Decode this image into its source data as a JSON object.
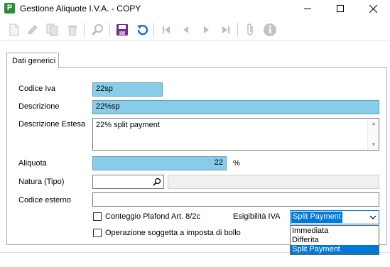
{
  "window": {
    "title": "Gestione Aliquote I.V.A. - COPY",
    "app_icon_letter": "P"
  },
  "toolbar": {
    "buttons": [
      {
        "name": "new",
        "icon": "new-document-icon"
      },
      {
        "name": "edit",
        "icon": "pencil-icon"
      },
      {
        "name": "copy",
        "icon": "copy-icon"
      },
      {
        "name": "delete",
        "icon": "trash-icon"
      },
      {
        "name": "search",
        "icon": "search-icon"
      },
      {
        "name": "save",
        "icon": "save-icon"
      },
      {
        "name": "undo",
        "icon": "undo-icon"
      },
      {
        "name": "first",
        "icon": "first-record-icon"
      },
      {
        "name": "previous",
        "icon": "previous-record-icon"
      },
      {
        "name": "next",
        "icon": "next-record-icon"
      },
      {
        "name": "last",
        "icon": "last-record-icon"
      },
      {
        "name": "attach",
        "icon": "paperclip-icon"
      },
      {
        "name": "info",
        "icon": "info-icon"
      }
    ]
  },
  "tab": {
    "label": "Dati generici"
  },
  "form": {
    "codice_iva": {
      "label": "Codice Iva",
      "value": "22sp"
    },
    "descrizione": {
      "label": "Descrizione",
      "value": "22%sp"
    },
    "descrizione_estesa": {
      "label": "Descrizione Estesa",
      "value": "22% split payment"
    },
    "aliquota": {
      "label": "Aliquota",
      "value": "22",
      "unit": "%"
    },
    "natura": {
      "label": "Natura (Tipo)",
      "value": "",
      "description": ""
    },
    "codice_esterno": {
      "label": "Codice esterno",
      "value": ""
    },
    "conteggio_plafond": {
      "label": "Conteggio Plafond Art. 8/2c",
      "checked": false
    },
    "operazione_bollo": {
      "label": "Operazione soggetta a imposta di bollo",
      "checked": false
    },
    "esigibilita": {
      "label": "Esigibilità IVA",
      "selected": "Split Payment",
      "options": [
        "Immediata",
        "Differita",
        "Split Payment"
      ]
    }
  },
  "colors": {
    "field_highlight": "#87cdea",
    "selection": "#0078d7",
    "save_icon": "#7a2a8c",
    "undo_icon": "#1e73be",
    "app_icon": "#2e8b3a"
  }
}
